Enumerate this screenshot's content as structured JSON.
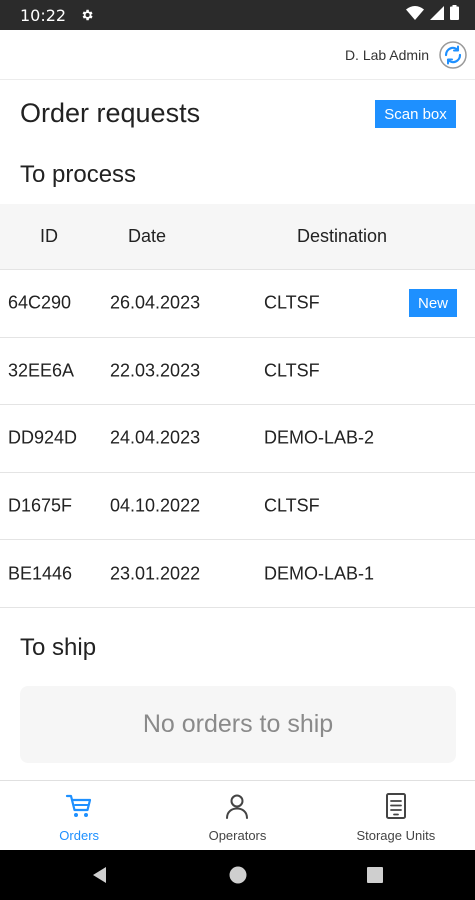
{
  "status_bar": {
    "time": "10:22",
    "icons": [
      "gear-icon",
      "wifi-icon",
      "signal-icon",
      "battery-icon"
    ]
  },
  "user": {
    "name": "D. Lab Admin",
    "icon": "sync-avatar-icon"
  },
  "header": {
    "title": "Order requests",
    "scan_label": "Scan box"
  },
  "to_process": {
    "title": "To process",
    "columns": [
      "ID",
      "Date",
      "Destination"
    ],
    "rows": [
      {
        "id": "64C290",
        "date": "26.04.2023",
        "destination": "CLTSF",
        "badge": "New"
      },
      {
        "id": "32EE6A",
        "date": "22.03.2023",
        "destination": "CLTSF",
        "badge": ""
      },
      {
        "id": "DD924D",
        "date": "24.04.2023",
        "destination": "DEMO-LAB-2",
        "badge": ""
      },
      {
        "id": "D1675F",
        "date": "04.10.2022",
        "destination": "CLTSF",
        "badge": ""
      },
      {
        "id": "BE1446",
        "date": "23.01.2022",
        "destination": "DEMO-LAB-1",
        "badge": ""
      }
    ]
  },
  "to_ship": {
    "title": "To ship",
    "empty_text": "No orders to ship"
  },
  "tabs": [
    {
      "label": "Orders",
      "icon": "cart-icon",
      "active": true
    },
    {
      "label": "Operators",
      "icon": "person-icon",
      "active": false
    },
    {
      "label": "Storage Units",
      "icon": "storage-unit-icon",
      "active": false
    }
  ],
  "colors": {
    "accent": "#1e90ff",
    "status_bar": "#2b2b2b",
    "nav_bar": "#000000",
    "table_header_bg": "#f6f6f6"
  }
}
